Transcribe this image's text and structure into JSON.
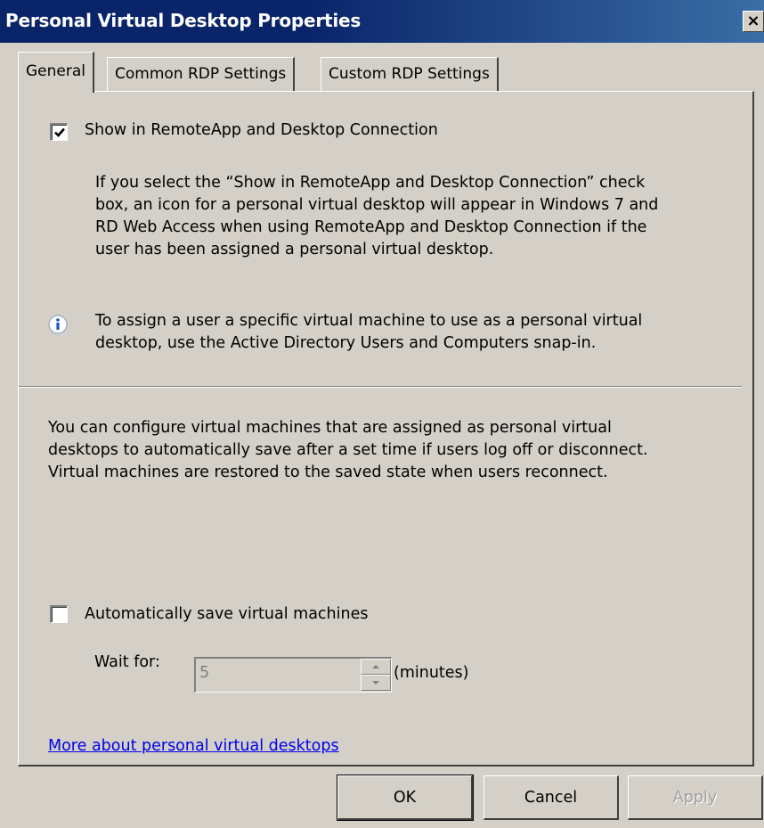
{
  "window": {
    "title": "Personal Virtual Desktop Properties",
    "close_glyph": "×"
  },
  "tabs": [
    {
      "label": "General",
      "active": true
    },
    {
      "label": "Common RDP Settings",
      "active": false
    },
    {
      "label": "Custom RDP Settings",
      "active": false
    }
  ],
  "general": {
    "show_checkbox": {
      "label": "Show in RemoteApp and Desktop Connection",
      "checked": true
    },
    "show_description": [
      "If you select the “Show in RemoteApp and Desktop Connection” check",
      "box, an icon for a personal virtual desktop will appear in Windows 7 and",
      "RD Web Access when using RemoteApp and Desktop Connection if the",
      "user has been assigned a personal virtual desktop."
    ],
    "info_note": [
      "To assign a user a specific virtual machine to use as a personal virtual",
      "desktop, use the Active Directory Users and Computers snap-in."
    ],
    "config_note": [
      "You can configure virtual machines that are assigned as personal virtual",
      "desktops to automatically save after a set time if users log off or disconnect.",
      "Virtual machines are restored to the saved state when users reconnect."
    ],
    "auto_save_checkbox": {
      "label": "Automatically save virtual machines",
      "checked": false
    },
    "wait_label": "Wait for:",
    "wait_value": "5",
    "wait_unit": "(minutes)",
    "more_link": "More about personal virtual desktops"
  },
  "buttons": {
    "ok": "OK",
    "cancel": "Cancel",
    "apply": "Apply"
  },
  "icons": {
    "info": "info-icon",
    "check": "check-icon",
    "close": "close-icon"
  },
  "colors": {
    "face": "#d4d0c8",
    "title_bar": "#0a246a",
    "link": "#0000ee"
  }
}
